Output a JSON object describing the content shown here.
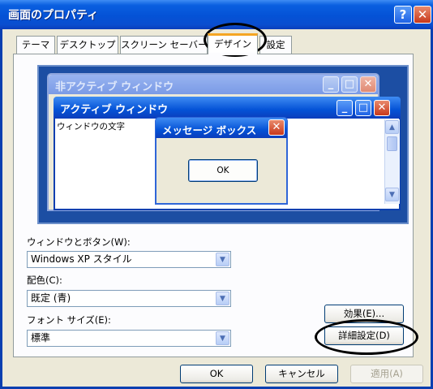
{
  "window": {
    "title": "画面のプロパティ",
    "help_glyph": "?",
    "close_glyph": "✕"
  },
  "tabs": [
    {
      "label": "テーマ"
    },
    {
      "label": "デスクトップ"
    },
    {
      "label": "スクリーン セーバー"
    },
    {
      "label": "デザイン",
      "selected": true
    },
    {
      "label": "設定"
    }
  ],
  "preview": {
    "inactive_title": "非アクティブ ウィンドウ",
    "active_title": "アクティブ ウィンドウ",
    "window_text": "ウィンドウの文字",
    "message_title": "メッセージ ボックス",
    "ok_label": "OK",
    "minimize_glyph": "_",
    "maximize_glyph": "□",
    "close_glyph": "✕",
    "scroll_up": "▲",
    "scroll_down": "▼"
  },
  "fields": {
    "window_style": {
      "label": "ウィンドウとボタン(W):",
      "value": "Windows XP スタイル"
    },
    "color_scheme": {
      "label": "配色(C):",
      "value": "既定 (青)"
    },
    "font_size": {
      "label": "フォント サイズ(E):",
      "value": "標準"
    },
    "dropdown_glyph": "▼"
  },
  "buttons": {
    "effects": "効果(E)...",
    "advanced": "詳細設定(D)",
    "ok": "OK",
    "cancel": "キャンセル",
    "apply": "適用(A)"
  },
  "colors": {
    "title_blue": "#0452d6",
    "dialog_face": "#ece9d8",
    "preview_bg": "#1c4ea3",
    "highlight_ring": "#000000",
    "tab_accent": "#f5a623"
  }
}
